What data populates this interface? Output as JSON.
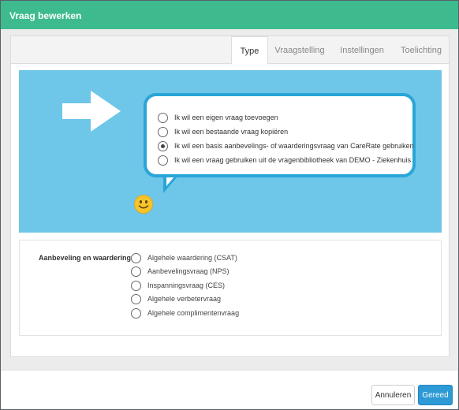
{
  "dialog": {
    "title": "Vraag bewerken"
  },
  "tabs": [
    {
      "label": "Type",
      "active": true
    },
    {
      "label": "Vraagstelling",
      "active": false
    },
    {
      "label": "Instellingen",
      "active": false
    },
    {
      "label": "Toelichting",
      "active": false
    }
  ],
  "banner": {
    "background_color": "#6ec6e8",
    "bubble_border_color": "#2aa5d8",
    "icons": [
      "arrow-right-icon",
      "smiley-icon"
    ],
    "options": [
      {
        "label": "Ik wil een eigen vraag toevoegen",
        "selected": false
      },
      {
        "label": "Ik wil een bestaande vraag kopiëren",
        "selected": false
      },
      {
        "label": "Ik wil een basis aanbevelings- of waarderingsvraag van CareRate gebruiken",
        "selected": true
      },
      {
        "label": "Ik wil een vraag gebruiken uit de vragenbibliotheek van DEMO - Ziekenhuis",
        "selected": false
      }
    ]
  },
  "section": {
    "label": "Aanbeveling en waardering",
    "options": [
      {
        "label": "Algehele waardering (CSAT)",
        "selected": false
      },
      {
        "label": "Aanbevelingsvraag (NPS)",
        "selected": false
      },
      {
        "label": "Inspanningsvraag (CES)",
        "selected": false
      },
      {
        "label": "Algehele verbetervraag",
        "selected": false
      },
      {
        "label": "Algehele complimentenvraag",
        "selected": false
      }
    ]
  },
  "footer": {
    "cancel_label": "Annuleren",
    "done_label": "Gereed"
  },
  "colors": {
    "header": "#3dbb8f",
    "primary_button": "#2d9ad6"
  }
}
